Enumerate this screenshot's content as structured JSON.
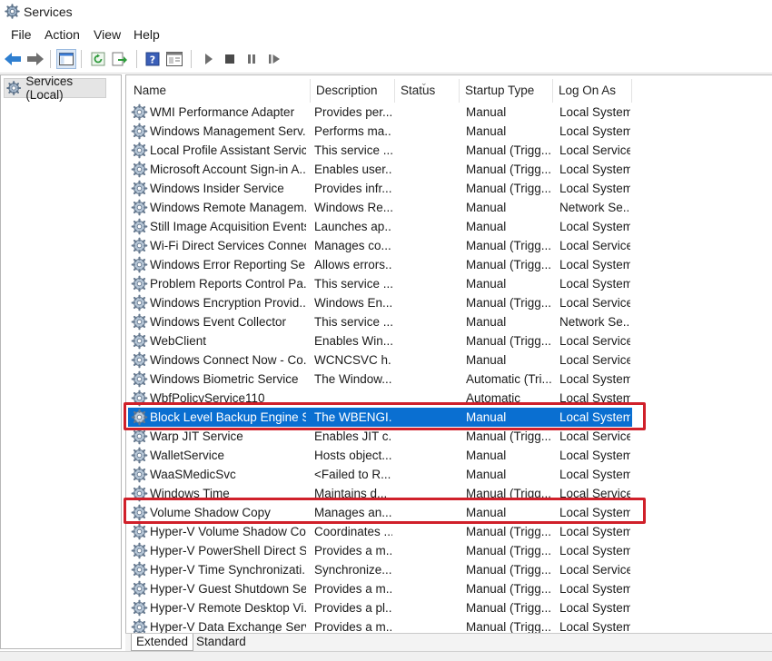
{
  "window": {
    "title": "Services"
  },
  "menu": [
    {
      "label": "File"
    },
    {
      "label": "Action"
    },
    {
      "label": "View"
    },
    {
      "label": "Help"
    }
  ],
  "toolbar": {
    "buttons": [
      "back-arrow-icon",
      "forward-arrow-icon",
      "show-hide-console-tree-icon",
      "refresh-icon",
      "export-list-icon",
      "help-icon",
      "properties-icon",
      "start-service-icon",
      "stop-service-icon",
      "pause-service-icon",
      "resume-service-icon"
    ]
  },
  "tree": {
    "label": "Services (Local)"
  },
  "columns": {
    "name": "Name",
    "description": "Description",
    "status": "Status",
    "startup_type": "Startup Type",
    "log_on_as": "Log On As"
  },
  "services": [
    {
      "name": "WMI Performance Adapter",
      "description": "Provides per...",
      "status": "",
      "startup": "Manual",
      "logon": "Local System"
    },
    {
      "name": "Windows Management Serv...",
      "description": "Performs ma...",
      "status": "",
      "startup": "Manual",
      "logon": "Local System"
    },
    {
      "name": "Local Profile Assistant Service",
      "description": "This service ...",
      "status": "",
      "startup": "Manual (Trigg...",
      "logon": "Local Service"
    },
    {
      "name": "Microsoft Account Sign-in A...",
      "description": "Enables user...",
      "status": "",
      "startup": "Manual (Trigg...",
      "logon": "Local System"
    },
    {
      "name": "Windows Insider Service",
      "description": "Provides infr...",
      "status": "",
      "startup": "Manual (Trigg...",
      "logon": "Local System"
    },
    {
      "name": "Windows Remote Managem...",
      "description": "Windows Re...",
      "status": "",
      "startup": "Manual",
      "logon": "Network Se..."
    },
    {
      "name": "Still Image Acquisition Events",
      "description": "Launches ap...",
      "status": "",
      "startup": "Manual",
      "logon": "Local System"
    },
    {
      "name": "Wi-Fi Direct Services Connec...",
      "description": "Manages co...",
      "status": "",
      "startup": "Manual (Trigg...",
      "logon": "Local Service"
    },
    {
      "name": "Windows Error Reporting Se...",
      "description": "Allows errors...",
      "status": "",
      "startup": "Manual (Trigg...",
      "logon": "Local System"
    },
    {
      "name": "Problem Reports Control Pa...",
      "description": "This service ...",
      "status": "",
      "startup": "Manual",
      "logon": "Local System"
    },
    {
      "name": "Windows Encryption Provid...",
      "description": "Windows En...",
      "status": "",
      "startup": "Manual (Trigg...",
      "logon": "Local Service"
    },
    {
      "name": "Windows Event Collector",
      "description": "This service ...",
      "status": "",
      "startup": "Manual",
      "logon": "Network Se..."
    },
    {
      "name": "WebClient",
      "description": "Enables Win...",
      "status": "",
      "startup": "Manual (Trigg...",
      "logon": "Local Service"
    },
    {
      "name": "Windows Connect Now - Co...",
      "description": "WCNCSVC h...",
      "status": "",
      "startup": "Manual",
      "logon": "Local Service"
    },
    {
      "name": "Windows Biometric Service",
      "description": "The Window...",
      "status": "",
      "startup": "Automatic (Tri...",
      "logon": "Local System"
    },
    {
      "name": "WbfPolicyService110",
      "description": "",
      "status": "",
      "startup": "Automatic",
      "logon": "Local System"
    },
    {
      "name": "Block Level Backup Engine S...",
      "description": "The WBENGI...",
      "status": "",
      "startup": "Manual",
      "logon": "Local System",
      "selected": true,
      "highlighted": true
    },
    {
      "name": "Warp JIT Service",
      "description": "Enables JIT c...",
      "status": "",
      "startup": "Manual (Trigg...",
      "logon": "Local Service"
    },
    {
      "name": "WalletService",
      "description": "Hosts object...",
      "status": "",
      "startup": "Manual",
      "logon": "Local System"
    },
    {
      "name": "WaaSMedicSvc",
      "description": "<Failed to R...",
      "status": "",
      "startup": "Manual",
      "logon": "Local System"
    },
    {
      "name": "Windows Time",
      "description": "Maintains d...",
      "status": "",
      "startup": "Manual (Trigg...",
      "logon": "Local Service"
    },
    {
      "name": "Volume Shadow Copy",
      "description": "Manages an...",
      "status": "",
      "startup": "Manual",
      "logon": "Local System",
      "highlighted": true
    },
    {
      "name": "Hyper-V Volume Shadow Co...",
      "description": "Coordinates ...",
      "status": "",
      "startup": "Manual (Trigg...",
      "logon": "Local System"
    },
    {
      "name": "Hyper-V PowerShell Direct S...",
      "description": "Provides a m...",
      "status": "",
      "startup": "Manual (Trigg...",
      "logon": "Local System"
    },
    {
      "name": "Hyper-V Time Synchronizati...",
      "description": "Synchronize...",
      "status": "",
      "startup": "Manual (Trigg...",
      "logon": "Local Service"
    },
    {
      "name": "Hyper-V Guest Shutdown Se...",
      "description": "Provides a m...",
      "status": "",
      "startup": "Manual (Trigg...",
      "logon": "Local System"
    },
    {
      "name": "Hyper-V Remote Desktop Vi...",
      "description": "Provides a pl...",
      "status": "",
      "startup": "Manual (Trigg...",
      "logon": "Local System"
    },
    {
      "name": "Hyper-V Data Exchange Serv...",
      "description": "Provides a m...",
      "status": "",
      "startup": "Manual (Trigg...",
      "logon": "Local System"
    }
  ],
  "tabs": [
    {
      "label": "Extended",
      "active": true
    },
    {
      "label": "Standard",
      "active": false
    }
  ],
  "colors": {
    "selection": "#0a6fd1",
    "highlight_box": "#d0202a"
  }
}
